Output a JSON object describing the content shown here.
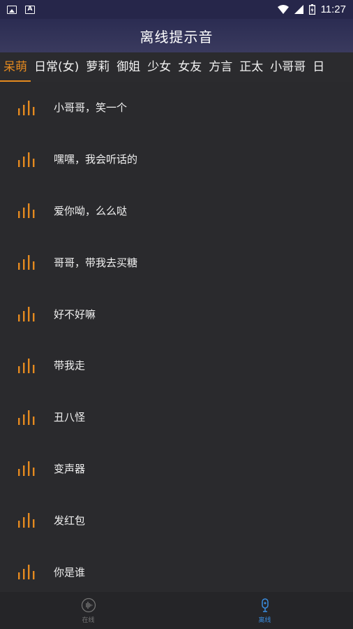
{
  "statusbar": {
    "time": "11:27",
    "icons": [
      "image-icon",
      "text-a-icon",
      "wifi-icon",
      "signal-icon",
      "battery-charging-icon"
    ]
  },
  "header": {
    "title": "离线提示音"
  },
  "tabs": [
    "呆萌",
    "日常(女)",
    "萝莉",
    "御姐",
    "少女",
    "女友",
    "方言",
    "正太",
    "小哥哥",
    "日"
  ],
  "active_tab": 0,
  "items": [
    {
      "label": "小哥哥，笑一个",
      "icon": "sound-wave-icon"
    },
    {
      "label": "嘿嘿，我会听话的",
      "icon": "sound-wave-icon"
    },
    {
      "label": "爱你呦，么么哒",
      "icon": "sound-wave-icon"
    },
    {
      "label": "哥哥，带我去买糖",
      "icon": "sound-wave-icon"
    },
    {
      "label": "好不好嘛",
      "icon": "sound-wave-icon"
    },
    {
      "label": "带我走",
      "icon": "sound-wave-icon"
    },
    {
      "label": "丑八怪",
      "icon": "sound-wave-icon"
    },
    {
      "label": "变声器",
      "icon": "sound-wave-icon"
    },
    {
      "label": "发红包",
      "icon": "sound-wave-icon"
    },
    {
      "label": "你是谁",
      "icon": "sound-wave-icon"
    }
  ],
  "bottom_nav": [
    {
      "label": "在线",
      "icon": "waveform-icon"
    },
    {
      "label": "离线",
      "icon": "microphone-icon"
    }
  ],
  "active_nav": 1,
  "colors": {
    "accent": "#e58a1f",
    "nav_active": "#3a8de0",
    "background": "#2a2a2d",
    "header": "#2b2c52"
  }
}
